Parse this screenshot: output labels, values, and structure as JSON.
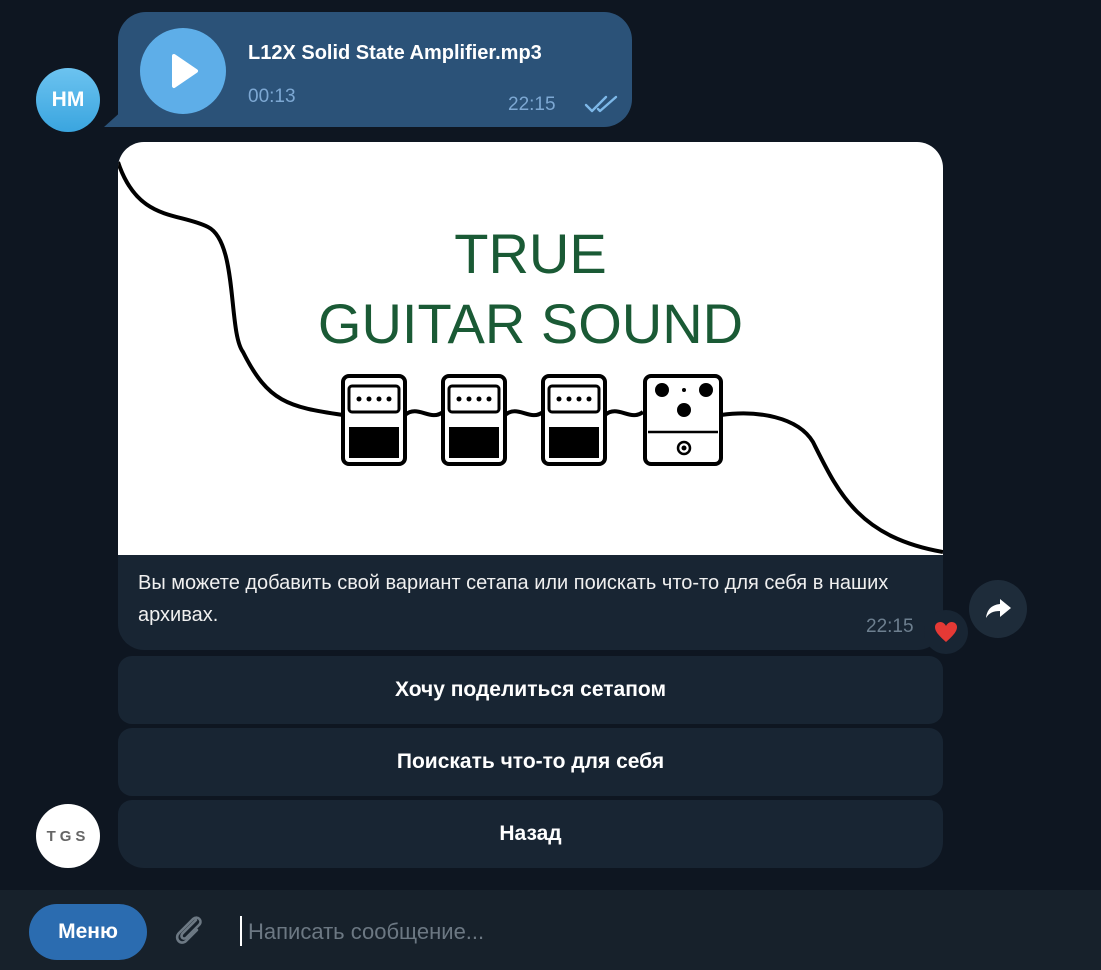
{
  "colors": {
    "chat_background": "#0e1621",
    "outgoing_bubble": "#2b5278",
    "incoming_bubble": "#182533",
    "play_button": "#5eaee8",
    "menu_button": "#2b6cb0",
    "banner_text": "#1a5a35",
    "reaction_heart": "#e53935"
  },
  "audio_message": {
    "sender_initials": "HM",
    "file_name": "L12X Solid State Amplifier.mp3",
    "duration": "00:13",
    "time": "22:15",
    "status_icon": "double-check-icon"
  },
  "bot_message": {
    "avatar_text": "TGS",
    "banner_title_line1": "TRUE",
    "banner_title_line2": "GUITAR SOUND",
    "caption": "Вы можете добавить свой вариант сетапа или поискать что-то для себя в наших архивах.",
    "time": "22:15",
    "reaction": "heart-icon"
  },
  "keyboard": {
    "share_setup": "Хочу поделиться сетапом",
    "search": "Поискать что-то для себя",
    "back": "Назад"
  },
  "composer": {
    "menu_label": "Меню",
    "placeholder": "Написать сообщение..."
  }
}
